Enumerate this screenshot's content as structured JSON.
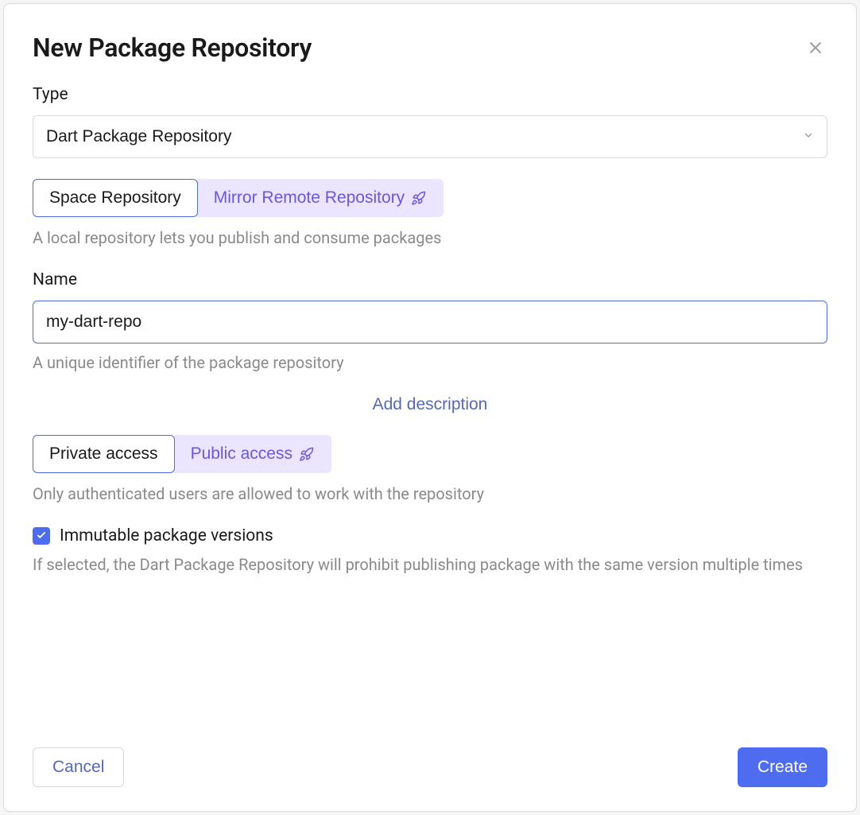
{
  "dialog": {
    "title": "New Package Repository"
  },
  "type": {
    "label": "Type",
    "value": "Dart Package Repository"
  },
  "repo_kind": {
    "options": {
      "space": "Space Repository",
      "mirror": "Mirror Remote Repository"
    },
    "helper": "A local repository lets you publish and consume packages"
  },
  "name": {
    "label": "Name",
    "value": "my-dart-repo",
    "helper": "A unique identifier of the package repository"
  },
  "add_description_label": "Add description",
  "access": {
    "options": {
      "private": "Private access",
      "public": "Public access"
    },
    "helper": "Only authenticated users are allowed to work with the repository"
  },
  "immutable": {
    "label": "Immutable package versions",
    "checked": true,
    "helper": "If selected, the Dart Package Repository will prohibit publishing package with the same version multiple times"
  },
  "footer": {
    "cancel": "Cancel",
    "create": "Create"
  }
}
